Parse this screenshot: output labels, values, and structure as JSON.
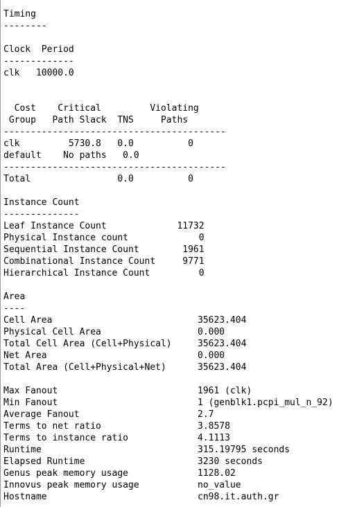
{
  "timing": {
    "title": "Timing",
    "underline": "--------",
    "clock_header": "Clock  Period",
    "clock_underline": "-------------",
    "clock_row": "clk   10000.0",
    "table_header_1": "  Cost    Critical         Violating",
    "table_header_2": " Group   Path Slack  TNS     Paths",
    "table_sep_1": "-----------------------------------------",
    "row_clk": "clk         5730.8   0.0          0",
    "row_default": "default    No paths   0.0",
    "table_sep_2": "-----------------------------------------",
    "row_total": "Total                0.0          0"
  },
  "instance_count": {
    "title": "Instance Count",
    "underline": "--------------",
    "rows": [
      "Leaf Instance Count             11732",
      "Physical Instance count             0",
      "Sequential Instance Count        1961",
      "Combinational Instance Count     9771",
      "Hierarchical Instance Count         0"
    ]
  },
  "area": {
    "title": "Area",
    "underline": "----",
    "rows": [
      {
        "label": "Cell Area",
        "value": "35623.404"
      },
      {
        "label": "Physical Cell Area",
        "value": "0.000"
      },
      {
        "label": "Total Cell Area (Cell+Physical)",
        "value": "35623.404"
      },
      {
        "label": "Net Area",
        "value": "0.000"
      },
      {
        "label": "Total Area (Cell+Physical+Net)",
        "value": "35623.404"
      }
    ]
  },
  "stats": {
    "rows": [
      {
        "label": "Max Fanout",
        "value": "1961 (clk)"
      },
      {
        "label": "Min Fanout",
        "value": "1 (genblk1.pcpi_mul_n_92)"
      },
      {
        "label": "Average Fanout",
        "value": "2.7"
      },
      {
        "label": "Terms to net ratio",
        "value": "3.8578"
      },
      {
        "label": "Terms to instance ratio",
        "value": "4.1113"
      },
      {
        "label": "Runtime",
        "value": "315.19795 seconds"
      },
      {
        "label": "Elapsed Runtime",
        "value": "3230 seconds"
      },
      {
        "label": "Genus peak memory usage",
        "value": "1128.02"
      },
      {
        "label": "Innovus peak memory usage",
        "value": "no_value"
      },
      {
        "label": "Hostname",
        "value": "cn98.it.auth.gr"
      }
    ]
  }
}
